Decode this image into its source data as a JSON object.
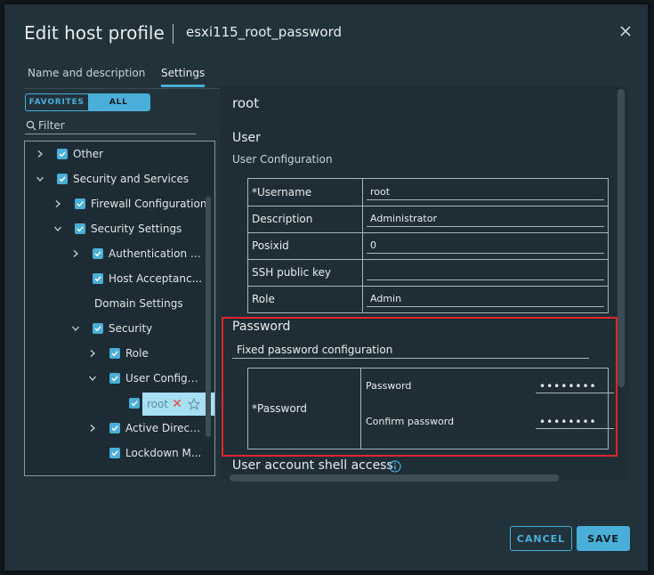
{
  "dialog": {
    "title": "Edit host profile",
    "subtitle": "esxi115_root_password"
  },
  "tabs": [
    {
      "label": "Name and description",
      "active": false
    },
    {
      "label": "Settings",
      "active": true
    }
  ],
  "tree_toggle": {
    "favorites_label": "FAVORITES",
    "all_label": "ALL",
    "selected": "ALL"
  },
  "filter": {
    "placeholder": "Filter",
    "value": ""
  },
  "tree": {
    "items": [
      {
        "label": "Other",
        "checked": true,
        "expanded": false
      },
      {
        "label": "Security and Services",
        "checked": true,
        "expanded": true
      },
      {
        "label": "Firewall Configuration",
        "checked": true,
        "expanded": false
      },
      {
        "label": "Security Settings",
        "checked": true,
        "expanded": true
      },
      {
        "label": "Authentication c...",
        "checked": true,
        "expanded": false
      },
      {
        "label": "Host Acceptanc...",
        "checked": true
      },
      {
        "label": "Domain Settings"
      },
      {
        "label": "Security",
        "checked": true,
        "expanded": true
      },
      {
        "label": "Role",
        "checked": true,
        "expanded": false
      },
      {
        "label": "User Configu...",
        "checked": true,
        "expanded": true
      },
      {
        "label": "root",
        "checked": true,
        "selected": true
      },
      {
        "label": "Active Direct...",
        "checked": true,
        "expanded": false
      },
      {
        "label": "Lockdown M...",
        "checked": true
      }
    ]
  },
  "detail": {
    "heading": "root",
    "user_section": "User",
    "user_config_label": "User Configuration",
    "user_fields": [
      {
        "label": "*Username",
        "value": "root"
      },
      {
        "label": "Description",
        "value": "Administrator"
      },
      {
        "label": "Posixid",
        "value": "0"
      },
      {
        "label": "SSH public key",
        "value": ""
      },
      {
        "label": "Role",
        "value": "Admin"
      }
    ],
    "password_section": "Password",
    "password_config": "Fixed password configuration",
    "password_label": "*Password",
    "password_sub_label": "Password",
    "password_value": "••••••••",
    "confirm_label": "Confirm password",
    "confirm_value": "••••••••",
    "shell_access": "User account shell access"
  },
  "buttons": {
    "cancel": "CANCEL",
    "save": "SAVE"
  },
  "colors": {
    "accent": "#49afd9",
    "highlight_border": "#e0252f",
    "dialog_bg": "#22323b"
  }
}
